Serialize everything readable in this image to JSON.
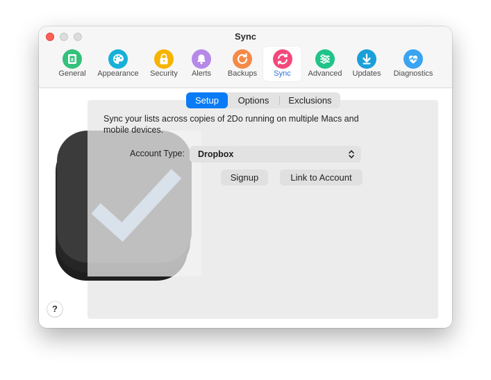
{
  "window": {
    "title": "Sync"
  },
  "toolbar": {
    "items": [
      {
        "label": "General",
        "icon": "general-icon",
        "color": "#34c17b"
      },
      {
        "label": "Appearance",
        "icon": "palette-icon",
        "color": "#18b0d8"
      },
      {
        "label": "Security",
        "icon": "lock-icon",
        "color": "#f6b400"
      },
      {
        "label": "Alerts",
        "icon": "bell-icon",
        "color": "#b589e8"
      },
      {
        "label": "Backups",
        "icon": "backup-icon",
        "color": "#f58a47"
      },
      {
        "label": "Sync",
        "icon": "sync-icon",
        "color": "#f3487b",
        "active": true
      },
      {
        "label": "Advanced",
        "icon": "sliders-icon",
        "color": "#20c488"
      },
      {
        "label": "Updates",
        "icon": "download-icon",
        "color": "#1a9fd8"
      },
      {
        "label": "Diagnostics",
        "icon": "pulse-icon",
        "color": "#3aa4f0"
      }
    ]
  },
  "tabs": {
    "items": [
      "Setup",
      "Options",
      "Exclusions"
    ],
    "selected": "Setup"
  },
  "setup": {
    "description": "Sync your lists across copies of 2Do running on multiple Macs and mobile devices.",
    "account_type_label": "Account Type:",
    "account_type_value": "Dropbox",
    "signup_label": "Signup",
    "link_label": "Link to Account"
  },
  "help": {
    "label": "?"
  },
  "colors": {
    "accent": "#0a7bf5",
    "active_label": "#1f6fde"
  }
}
